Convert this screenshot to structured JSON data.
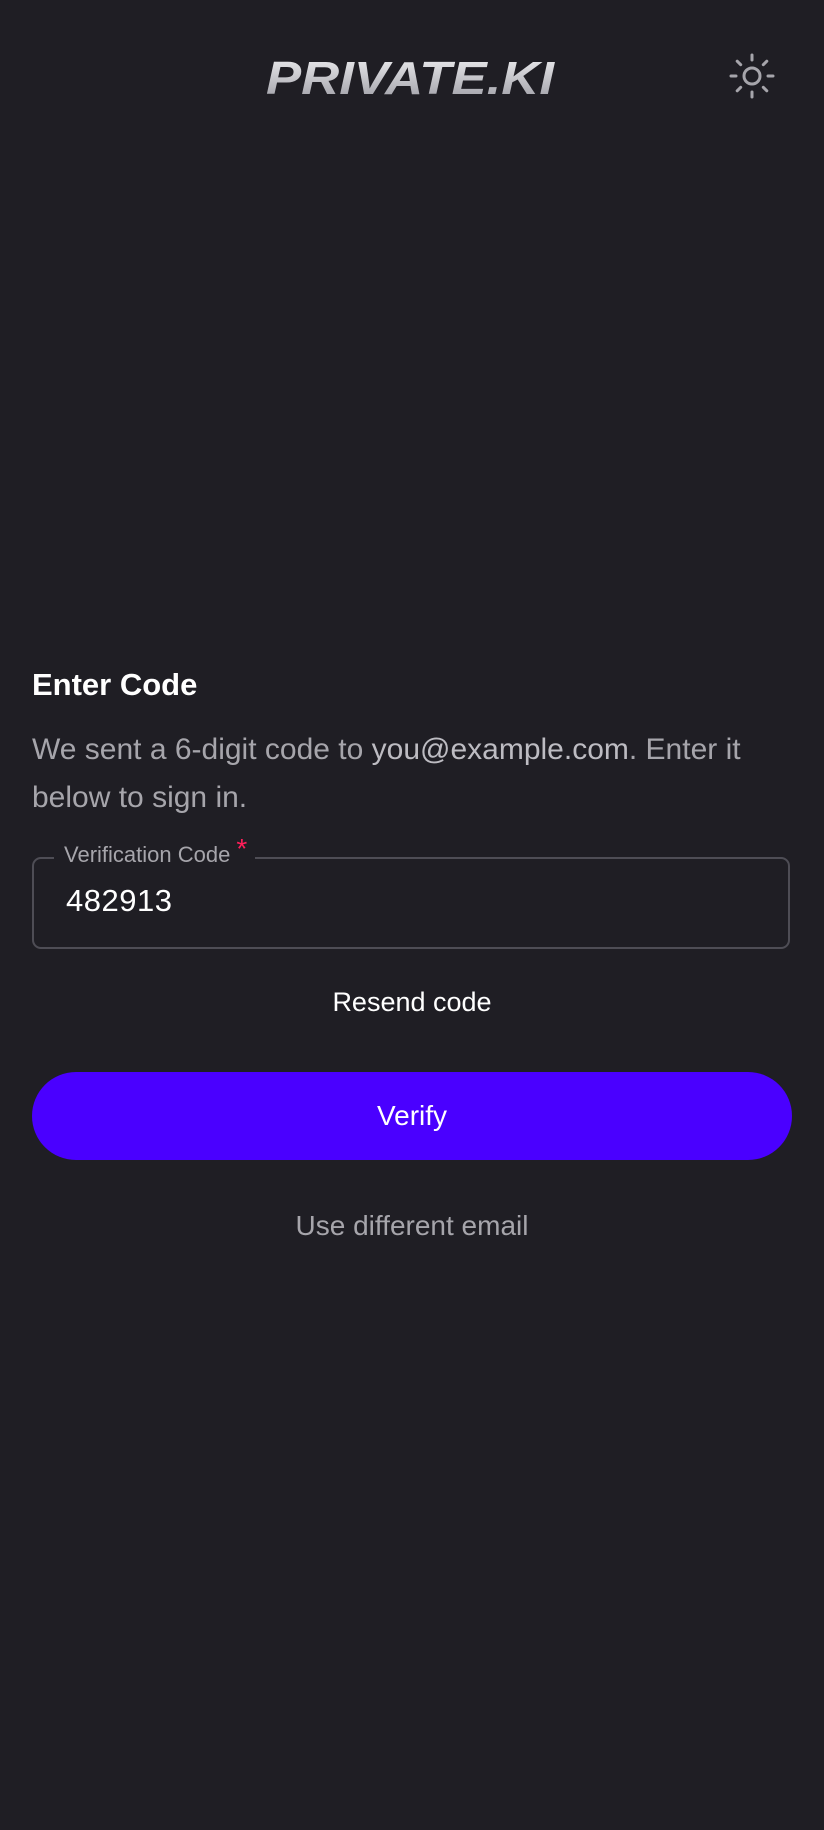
{
  "header": {
    "logo_text": "PRIVATE.KI",
    "theme_icon": "sun-icon"
  },
  "main": {
    "title": "Enter Code",
    "description_prefix": "We sent a 6-digit code to ",
    "email": "you@example.com",
    "description_suffix": ". Enter it below to sign in.",
    "code_field": {
      "label": "Verification Code",
      "required_mark": "*",
      "value": "482913"
    },
    "resend_label": "Resend code",
    "verify_label": "Verify",
    "different_email_label": "Use different email"
  },
  "colors": {
    "background": "#1f1e24",
    "primary": "#4a00ff",
    "required": "#ff1f5a",
    "muted_text": "#a6a5ab"
  }
}
